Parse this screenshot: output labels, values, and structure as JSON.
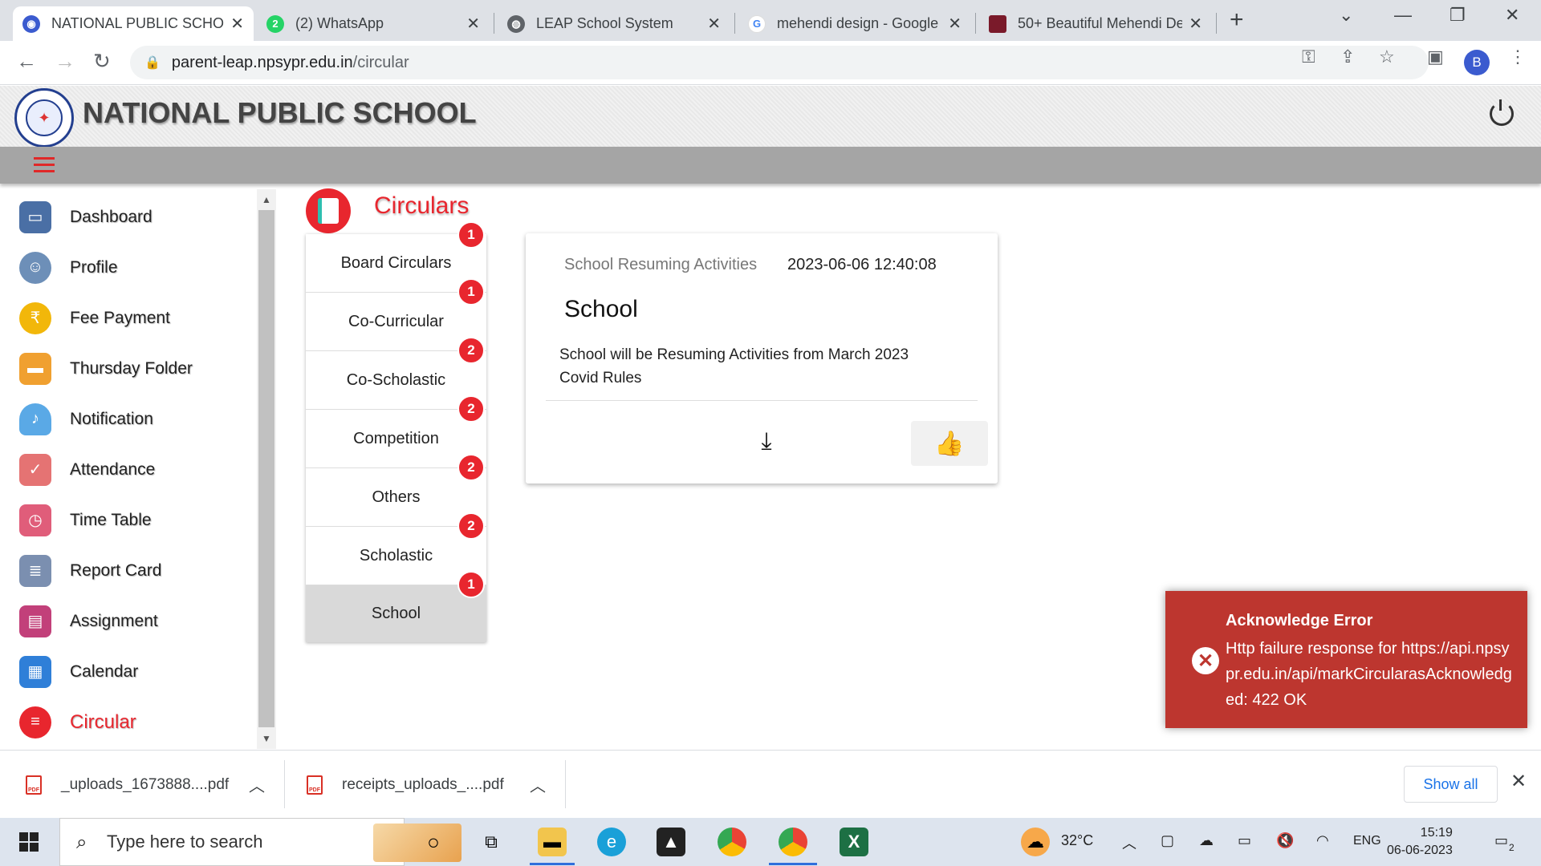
{
  "browser": {
    "tabs": [
      {
        "title": "NATIONAL PUBLIC SCHOO",
        "favicon": "school-icon",
        "color": "#3b5bcf"
      },
      {
        "title": "(2) WhatsApp",
        "favicon": "whatsapp-icon",
        "color": "#25d366",
        "badge": "2"
      },
      {
        "title": "LEAP School System",
        "favicon": "globe-icon",
        "color": "#5f6368"
      },
      {
        "title": "mehendi design - Google",
        "favicon": "google-icon",
        "color": "#4285f4"
      },
      {
        "title": "50+ Beautiful Mehendi De",
        "favicon": "image-icon",
        "color": "#7a1a2a"
      }
    ],
    "url_host": "parent-leap.npsypr.edu.in",
    "url_path": "/circular",
    "profile_initial": "B"
  },
  "app": {
    "school_name": "NATIONAL PUBLIC SCHOOL",
    "accent": "#e8262e"
  },
  "sidebar": {
    "items": [
      {
        "label": "Dashboard",
        "icon": "monitor-icon",
        "color": "#4a6fa5"
      },
      {
        "label": "Profile",
        "icon": "user-icon",
        "color": "#6d8fb8"
      },
      {
        "label": "Fee Payment",
        "icon": "rupee-icon",
        "color": "#f2b70a"
      },
      {
        "label": "Thursday Folder",
        "icon": "folder-icon",
        "color": "#f0a030"
      },
      {
        "label": "Notification",
        "icon": "bell-icon",
        "color": "#5aa9e6"
      },
      {
        "label": "Attendance",
        "icon": "calendar-check-icon",
        "color": "#e57373"
      },
      {
        "label": "Time Table",
        "icon": "calendar-clock-icon",
        "color": "#e05d7a"
      },
      {
        "label": "Report Card",
        "icon": "report-card-icon",
        "color": "#7b8fb0"
      },
      {
        "label": "Assignment",
        "icon": "book-icon",
        "color": "#c2407a"
      },
      {
        "label": "Calendar",
        "icon": "calendar-icon",
        "color": "#2f7fd8"
      },
      {
        "label": "Circular",
        "icon": "circular-icon",
        "color": "#e8262e",
        "active": true
      }
    ]
  },
  "page": {
    "title": "Circulars",
    "categories": [
      {
        "label": "Board Circulars",
        "count": "1"
      },
      {
        "label": "Co-Curricular",
        "count": "1"
      },
      {
        "label": "Co-Scholastic",
        "count": "2"
      },
      {
        "label": "Competition",
        "count": "2"
      },
      {
        "label": "Others",
        "count": "2"
      },
      {
        "label": "Scholastic",
        "count": "2"
      },
      {
        "label": "School",
        "count": "1",
        "selected": true
      }
    ],
    "card": {
      "subject": "School Resuming Activities",
      "datetime": "2023-06-06 12:40:08",
      "heading": "School",
      "body_line1": "School will be Resuming Activities from March 2023",
      "body_line2": "Covid Rules"
    }
  },
  "toast": {
    "title": "Acknowledge Error",
    "message": "Http failure response for https://api.npsypr.edu.in/api/markCircularasAcknowledged: 422 OK"
  },
  "downloads": {
    "items": [
      {
        "name": "_uploads_1673888....pdf"
      },
      {
        "name": "receipts_uploads_....pdf"
      }
    ],
    "show_all": "Show all"
  },
  "taskbar": {
    "search_placeholder": "Type here to search",
    "weather": "32°C",
    "lang": "ENG",
    "time": "15:19",
    "date": "06-06-2023",
    "notif_count": "2"
  }
}
